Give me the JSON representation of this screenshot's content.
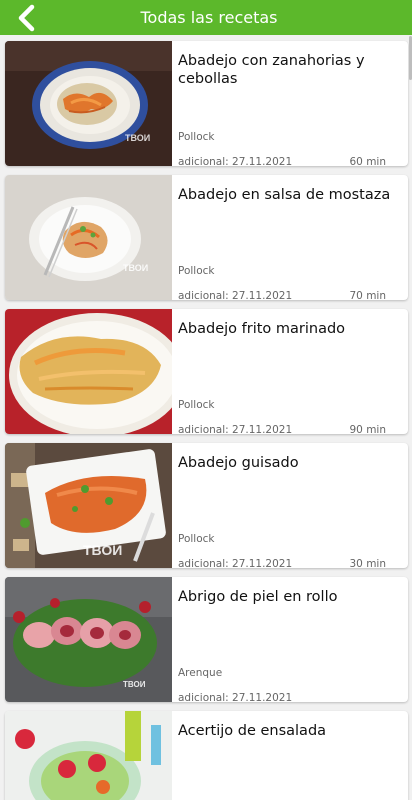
{
  "header": {
    "title": "Todas las recetas",
    "back_icon": "chevron-left-icon",
    "color": "#5cb82b"
  },
  "recipes": [
    {
      "name": "Abadejo con zanahorias y cebollas",
      "category": "Pollock",
      "date": "adicional: 27.11.2021",
      "time": "60 min"
    },
    {
      "name": "Abadejo en salsa de mostaza",
      "category": "Pollock",
      "date": "adicional: 27.11.2021",
      "time": "70 min"
    },
    {
      "name": "Abadejo frito marinado",
      "category": "Pollock",
      "date": "adicional: 27.11.2021",
      "time": "90 min"
    },
    {
      "name": "Abadejo guisado",
      "category": "Pollock",
      "date": "adicional: 27.11.2021",
      "time": "30 min"
    },
    {
      "name": "Abrigo de piel en rollo",
      "category": "Arenque",
      "date": "adicional: 27.11.2021",
      "time": ""
    },
    {
      "name": "Acertijo de ensalada",
      "category": "",
      "date": "",
      "time": ""
    }
  ]
}
